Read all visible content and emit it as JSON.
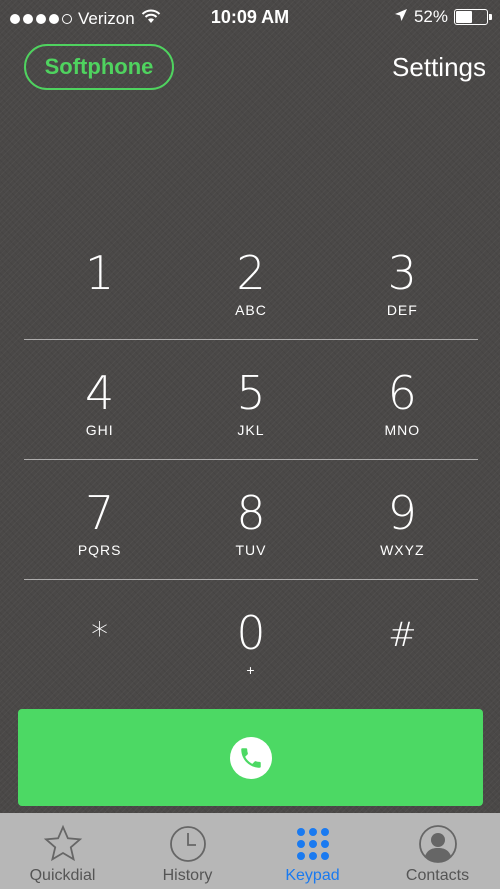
{
  "status_bar": {
    "carrier": "Verizon",
    "time": "10:09 AM",
    "battery_percent": "52%",
    "battery_level": 0.52
  },
  "header": {
    "softphone_label": "Softphone",
    "settings_label": "Settings"
  },
  "keypad": {
    "rows": [
      [
        {
          "digit": "1",
          "letters": ""
        },
        {
          "digit": "2",
          "letters": "ABC"
        },
        {
          "digit": "3",
          "letters": "DEF"
        }
      ],
      [
        {
          "digit": "4",
          "letters": "GHI"
        },
        {
          "digit": "5",
          "letters": "JKL"
        },
        {
          "digit": "6",
          "letters": "MNO"
        }
      ],
      [
        {
          "digit": "7",
          "letters": "PQRS"
        },
        {
          "digit": "8",
          "letters": "TUV"
        },
        {
          "digit": "9",
          "letters": "WXYZ"
        }
      ],
      [
        {
          "digit": "*",
          "letters": ""
        },
        {
          "digit": "0",
          "letters": "+"
        },
        {
          "digit": "#",
          "letters": ""
        }
      ]
    ]
  },
  "call_button": {
    "icon": "phone-icon",
    "color": "#4cd964"
  },
  "tabs": [
    {
      "label": "Quickdial",
      "icon": "star-icon",
      "active": false
    },
    {
      "label": "History",
      "icon": "clock-icon",
      "active": false
    },
    {
      "label": "Keypad",
      "icon": "keypad-grid-icon",
      "active": true
    },
    {
      "label": "Contacts",
      "icon": "contact-icon",
      "active": false
    }
  ],
  "colors": {
    "accent_green": "#4fd35f",
    "active_tab_blue": "#1a7af0",
    "background": "#4a4847"
  }
}
